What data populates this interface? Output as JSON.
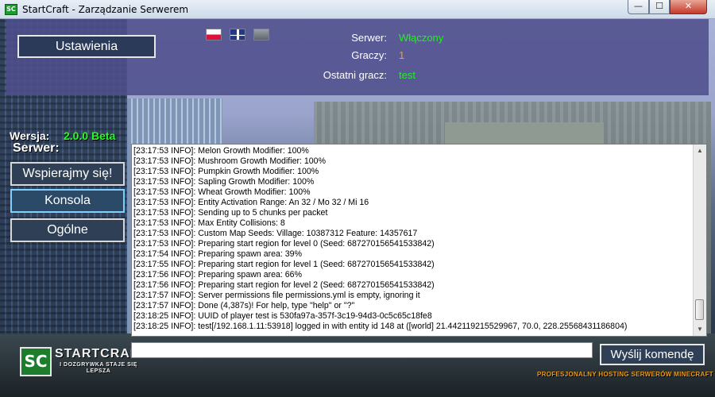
{
  "window": {
    "title": "StartCraft - Zarządzanie Serwerem",
    "app_icon_text": "SC",
    "min_glyph": "—",
    "max_glyph": "☐",
    "close_glyph": "✕"
  },
  "header": {
    "settings_label": "Ustawienia",
    "flags": [
      "polish-flag",
      "uk-flag",
      "generic-flag"
    ],
    "server_label": "Serwer:",
    "server_value": "Włączony",
    "players_label": "Graczy:",
    "players_value": "1",
    "last_player_label": "Ostatni gracz:",
    "last_player_value": "test",
    "colors": {
      "server_value": "#22ee22",
      "players_value": "#ff9a1a",
      "last_player_value": "#22ee22"
    }
  },
  "sidebar": {
    "version_label": "Wersja:",
    "version_value": "2.0.0 Beta",
    "server_section_label": "Serwer:",
    "buttons": [
      {
        "label": "Wspierajmy się!",
        "active": false
      },
      {
        "label": "Konsola",
        "active": true
      },
      {
        "label": "Ogólne",
        "active": false
      }
    ]
  },
  "console": {
    "lines": [
      "[23:17:53 INFO]: Melon Growth Modifier: 100%",
      "[23:17:53 INFO]: Mushroom Growth Modifier: 100%",
      "[23:17:53 INFO]: Pumpkin Growth Modifier: 100%",
      "[23:17:53 INFO]: Sapling Growth Modifier: 100%",
      "[23:17:53 INFO]: Wheat Growth Modifier: 100%",
      "[23:17:53 INFO]: Entity Activation Range: An 32 / Mo 32 / Mi 16",
      "[23:17:53 INFO]: Sending up to 5 chunks per packet",
      "[23:17:53 INFO]: Max Entity Collisions: 8",
      "[23:17:53 INFO]: Custom Map Seeds:  Village: 10387312 Feature: 14357617",
      "[23:17:53 INFO]: Preparing start region for level 0 (Seed: 687270156541533842)",
      "[23:17:54 INFO]: Preparing spawn area: 39%",
      "[23:17:55 INFO]: Preparing start region for level 1 (Seed: 687270156541533842)",
      "[23:17:56 INFO]: Preparing spawn area: 66%",
      "[23:17:56 INFO]: Preparing start region for level 2 (Seed: 687270156541533842)",
      "[23:17:57 INFO]: Server permissions file permissions.yml is empty, ignoring it",
      "[23:17:57 INFO]: Done (4,387s)! For help, type \"help\" or \"?\"",
      "[23:18:25 INFO]: UUID of player test is 530fa97a-357f-3c19-94d3-0c5c65c18fe8",
      "[23:18:25 INFO]: test[/192.168.1.11:53918] logged in with entity id 148 at ([world] 21.442119215529967, 70.0, 228.25568431186804)"
    ]
  },
  "command": {
    "input_value": "",
    "send_label": "Wyślij komendę"
  },
  "branding": {
    "logo_mark": "SC",
    "logo_name": "STARTCRAFT",
    "logo_tagline": "I DOZGRYWKA STAJE SIĘ LEPSZA",
    "promo_text": "PROFESJONALNY HOSTING SERWERÓW MINECRAFT"
  }
}
